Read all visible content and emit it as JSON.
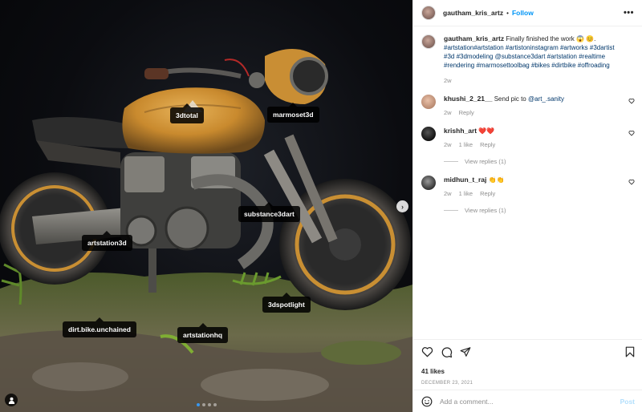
{
  "post": {
    "username": "gautham_kris_artz",
    "follow_label": "Follow",
    "more_label": "•••",
    "caption": "Finally finished the work 😱 😊.",
    "hashtags": "#artstation#artstation #artistoninstagram #artworks #3dartist #3d #3dmodeling @substance3dart #artstation #realtime #rendering #marmosettoolbag #bikes #dirtbike #offroading",
    "caption_time": "2w",
    "likes": "41 likes",
    "date": "DECEMBER 23, 2021"
  },
  "media": {
    "tags": [
      {
        "label": "3dtotal"
      },
      {
        "label": "marmoset3d"
      },
      {
        "label": "substance3dart"
      },
      {
        "label": "artstation3d"
      },
      {
        "label": "3dspotlight"
      },
      {
        "label": "dirt.bike.unchained"
      },
      {
        "label": "artstationhq"
      }
    ],
    "carousel_index": 1,
    "carousel_total": 4,
    "next_label": "›"
  },
  "comments": [
    {
      "user": "khushi_2_21__",
      "text": "Send pic to ",
      "mention": "@art_.sanity",
      "time": "2w",
      "likes": "",
      "reply": "Reply",
      "view_replies": ""
    },
    {
      "user": "krishh_art",
      "text": "❤️❤️",
      "mention": "",
      "time": "2w",
      "likes": "1 like",
      "reply": "Reply",
      "view_replies": "View replies (1)"
    },
    {
      "user": "midhun_t_raj",
      "text": "👏👏",
      "mention": "",
      "time": "2w",
      "likes": "1 like",
      "reply": "Reply",
      "view_replies": "View replies (1)"
    }
  ],
  "add_comment": {
    "placeholder": "Add a comment...",
    "post_label": "Post"
  },
  "colors": {
    "accent": "#0095f6",
    "muted": "#8e8e8e",
    "post_disabled": "#b2dffc",
    "bike_tank": "#d89a3a"
  }
}
